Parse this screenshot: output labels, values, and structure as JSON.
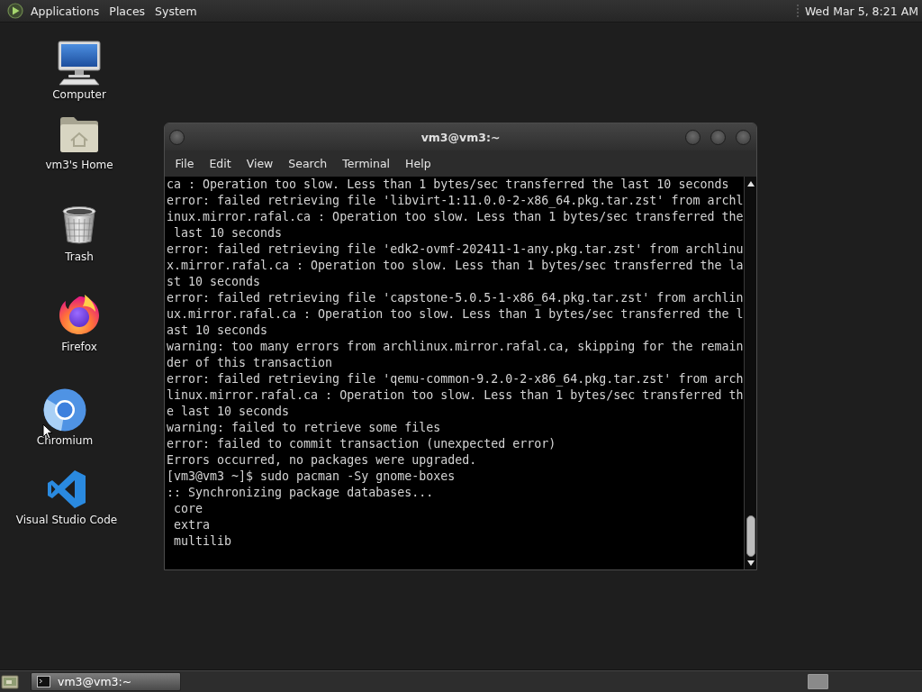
{
  "top_panel": {
    "menus": [
      {
        "label": "Applications"
      },
      {
        "label": "Places"
      },
      {
        "label": "System"
      }
    ],
    "clock": "Wed Mar 5, 8:21 AM"
  },
  "desktop_icons": [
    {
      "label": "Computer",
      "kind": "computer"
    },
    {
      "label": "vm3's Home",
      "kind": "home"
    },
    {
      "label": "Trash",
      "kind": "trash"
    },
    {
      "label": "Firefox",
      "kind": "firefox"
    },
    {
      "label": "Chromium",
      "kind": "chromium"
    },
    {
      "label": "Visual Studio Code",
      "kind": "vscode"
    }
  ],
  "terminal_window": {
    "title": "vm3@vm3:~",
    "menus": [
      "File",
      "Edit",
      "View",
      "Search",
      "Terminal",
      "Help"
    ],
    "lines": [
      "ca : Operation too slow. Less than 1 bytes/sec transferred the last 10 seconds",
      "error: failed retrieving file 'libvirt-1:11.0.0-2-x86_64.pkg.tar.zst' from archl",
      "inux.mirror.rafal.ca : Operation too slow. Less than 1 bytes/sec transferred the",
      " last 10 seconds",
      "error: failed retrieving file 'edk2-ovmf-202411-1-any.pkg.tar.zst' from archlinu",
      "x.mirror.rafal.ca : Operation too slow. Less than 1 bytes/sec transferred the la",
      "st 10 seconds",
      "error: failed retrieving file 'capstone-5.0.5-1-x86_64.pkg.tar.zst' from archlin",
      "ux.mirror.rafal.ca : Operation too slow. Less than 1 bytes/sec transferred the l",
      "ast 10 seconds",
      "warning: too many errors from archlinux.mirror.rafal.ca, skipping for the remain",
      "der of this transaction",
      "error: failed retrieving file 'qemu-common-9.2.0-2-x86_64.pkg.tar.zst' from arch",
      "linux.mirror.rafal.ca : Operation too slow. Less than 1 bytes/sec transferred th",
      "e last 10 seconds",
      "warning: failed to retrieve some files",
      "error: failed to commit transaction (unexpected error)",
      "Errors occurred, no packages were upgraded.",
      "[vm3@vm3 ~]$ sudo pacman -Sy gnome-boxes",
      ":: Synchronizing package databases...",
      " core",
      " extra",
      " multilib"
    ]
  },
  "taskbar": {
    "tasks": [
      {
        "label": "vm3@vm3:~",
        "selected": true
      }
    ]
  }
}
